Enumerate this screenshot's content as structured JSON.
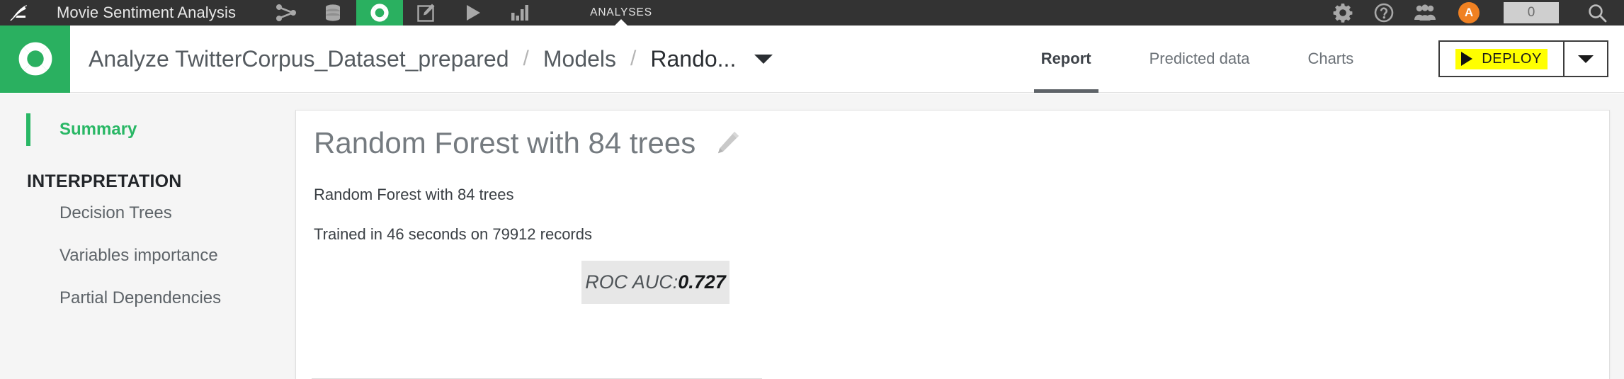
{
  "topbar": {
    "bird_icon": "bird-logo-icon",
    "project_title": "Movie Sentiment Analysis",
    "icons": [
      {
        "name": "flow-icon",
        "label": "Flow"
      },
      {
        "name": "datasets-icon",
        "label": "Datasets"
      },
      {
        "name": "lab-donut-icon",
        "label": "Lab",
        "active": true
      },
      {
        "name": "notebooks-edit-icon",
        "label": "Notebooks"
      },
      {
        "name": "run-play-icon",
        "label": "Jobs"
      },
      {
        "name": "chart-bars-icon",
        "label": "Dashboards"
      }
    ],
    "section_label": "ANALYSES",
    "right_icons": [
      {
        "name": "gear-icon",
        "label": "Settings"
      },
      {
        "name": "help-question-icon",
        "label": "Help"
      },
      {
        "name": "users-team-icon",
        "label": "Collaborators"
      }
    ],
    "avatar_initial": "A",
    "notification_count": "0",
    "search_icon": "search-icon"
  },
  "header": {
    "logo_icon": "dataiku-donut-logo-icon",
    "breadcrumb": {
      "root": "Analyze TwitterCorpus_Dataset_prepared",
      "sep": "/",
      "middle": "Models",
      "current": "Rando...",
      "caret_icon": "chevron-down-icon"
    },
    "tabs": [
      {
        "label": "Report",
        "active": true
      },
      {
        "label": "Predicted data",
        "active": false
      },
      {
        "label": "Charts",
        "active": false
      }
    ],
    "deploy": {
      "label": "DEPLOY",
      "play_icon": "play-triangle-icon",
      "caret_icon": "chevron-down-icon",
      "highlight_color": "#ffff00"
    }
  },
  "sidebar": {
    "active_item": "Summary",
    "section_header": "INTERPRETATION",
    "items": [
      {
        "label": "Decision Trees"
      },
      {
        "label": "Variables importance"
      },
      {
        "label": "Partial Dependencies"
      }
    ]
  },
  "content": {
    "title": "Random Forest with 84 trees",
    "edit_icon": "pencil-edit-icon",
    "description": "Random Forest with 84 trees",
    "training_info": "Trained in 46 seconds on 79912 records",
    "metric": {
      "label": "ROC AUC:",
      "value": "0.727"
    }
  },
  "colors": {
    "brand_green": "#2ab060",
    "accent_green": "#29b765",
    "topbar_dark": "#333333",
    "avatar_orange": "#f08122",
    "highlight_yellow": "#ffff00"
  }
}
